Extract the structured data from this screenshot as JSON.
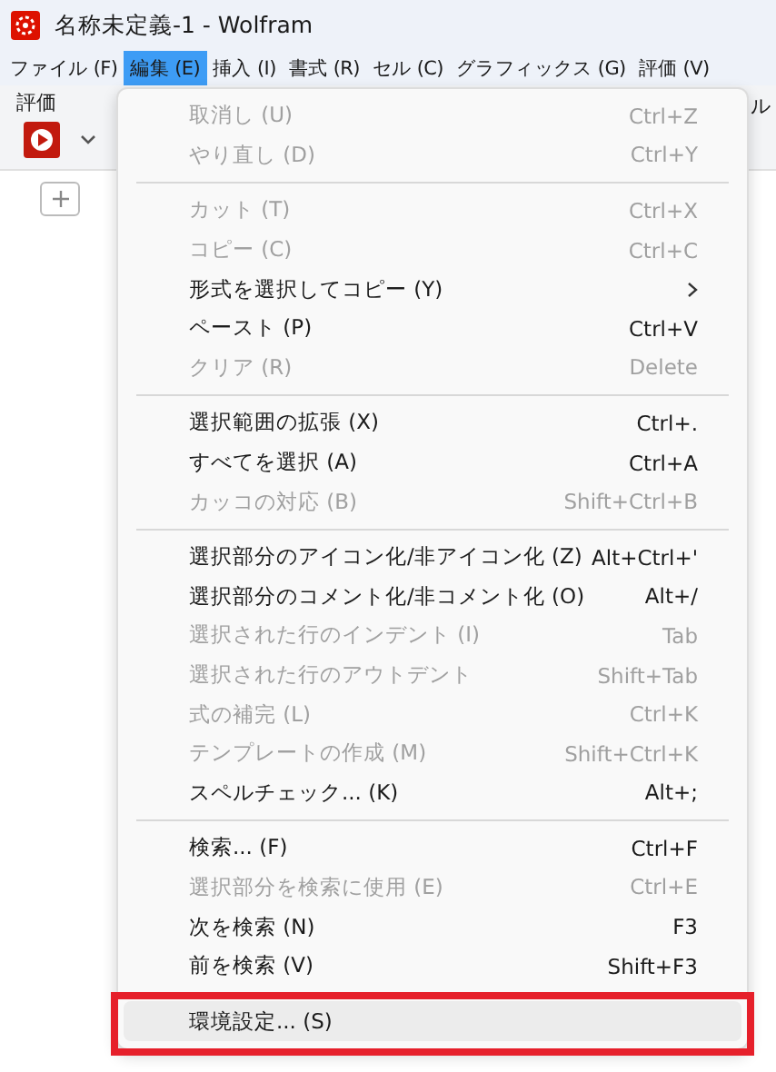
{
  "window": {
    "title": "名称未定義-1 - Wolfram"
  },
  "menubar": [
    {
      "label": "ファイル (F)",
      "selected": false
    },
    {
      "label": "編集 (E)",
      "selected": true
    },
    {
      "label": "挿入 (I)",
      "selected": false
    },
    {
      "label": "書式 (R)",
      "selected": false
    },
    {
      "label": "セル (C)",
      "selected": false
    },
    {
      "label": "グラフィックス (G)",
      "selected": false
    },
    {
      "label": "評価 (V)",
      "selected": false
    }
  ],
  "toolbar": {
    "group_label": "評価",
    "right_label_fragment": "ル"
  },
  "menu": {
    "groups": [
      {
        "items": [
          {
            "label": "取消し (U)",
            "shortcut": "Ctrl+Z",
            "disabled": true,
            "selected": false
          },
          {
            "label": "やり直し (D)",
            "shortcut": "Ctrl+Y",
            "disabled": true,
            "selected": false
          }
        ]
      },
      {
        "items": [
          {
            "label": "カット (T)",
            "shortcut": "Ctrl+X",
            "disabled": true,
            "selected": false
          },
          {
            "label": "コピー (C)",
            "shortcut": "Ctrl+C",
            "disabled": true,
            "selected": false
          },
          {
            "label": "形式を選択してコピー (Y)",
            "submenu": true,
            "disabled": false,
            "selected": false
          },
          {
            "label": "ペースト (P)",
            "shortcut": "Ctrl+V",
            "disabled": false,
            "selected": false
          },
          {
            "label": "クリア (R)",
            "shortcut": "Delete",
            "disabled": true,
            "selected": false
          }
        ]
      },
      {
        "items": [
          {
            "label": "選択範囲の拡張 (X)",
            "shortcut": "Ctrl+.",
            "disabled": false,
            "selected": false
          },
          {
            "label": "すべてを選択 (A)",
            "shortcut": "Ctrl+A",
            "disabled": false,
            "selected": false
          },
          {
            "label": "カッコの対応 (B)",
            "shortcut": "Shift+Ctrl+B",
            "disabled": true,
            "selected": false
          }
        ]
      },
      {
        "items": [
          {
            "label": "選択部分のアイコン化/非アイコン化 (Z)",
            "shortcut": "Alt+Ctrl+'",
            "disabled": false,
            "selected": false
          },
          {
            "label": "選択部分のコメント化/非コメント化 (O)",
            "shortcut": "Alt+/",
            "disabled": false,
            "selected": false
          },
          {
            "label": "選択された行のインデント (I)",
            "shortcut": "Tab",
            "disabled": true,
            "selected": false
          },
          {
            "label": "選択された行のアウトデント",
            "shortcut": "Shift+Tab",
            "disabled": true,
            "selected": false
          },
          {
            "label": "式の補完 (L)",
            "shortcut": "Ctrl+K",
            "disabled": true,
            "selected": false
          },
          {
            "label": "テンプレートの作成 (M)",
            "shortcut": "Shift+Ctrl+K",
            "disabled": true,
            "selected": false
          },
          {
            "label": "スペルチェック... (K)",
            "shortcut": "Alt+;",
            "disabled": false,
            "selected": false
          }
        ]
      },
      {
        "items": [
          {
            "label": "検索... (F)",
            "shortcut": "Ctrl+F",
            "disabled": false,
            "selected": false
          },
          {
            "label": "選択部分を検索に使用 (E)",
            "shortcut": "Ctrl+E",
            "disabled": true,
            "selected": false
          },
          {
            "label": "次を検索 (N)",
            "shortcut": "F3",
            "disabled": false,
            "selected": false
          },
          {
            "label": "前を検索 (V)",
            "shortcut": "Shift+F3",
            "disabled": false,
            "selected": false
          }
        ]
      },
      {
        "items": [
          {
            "label": "環境設定... (S)",
            "disabled": false,
            "selected": true,
            "framed": true
          }
        ]
      }
    ]
  }
}
